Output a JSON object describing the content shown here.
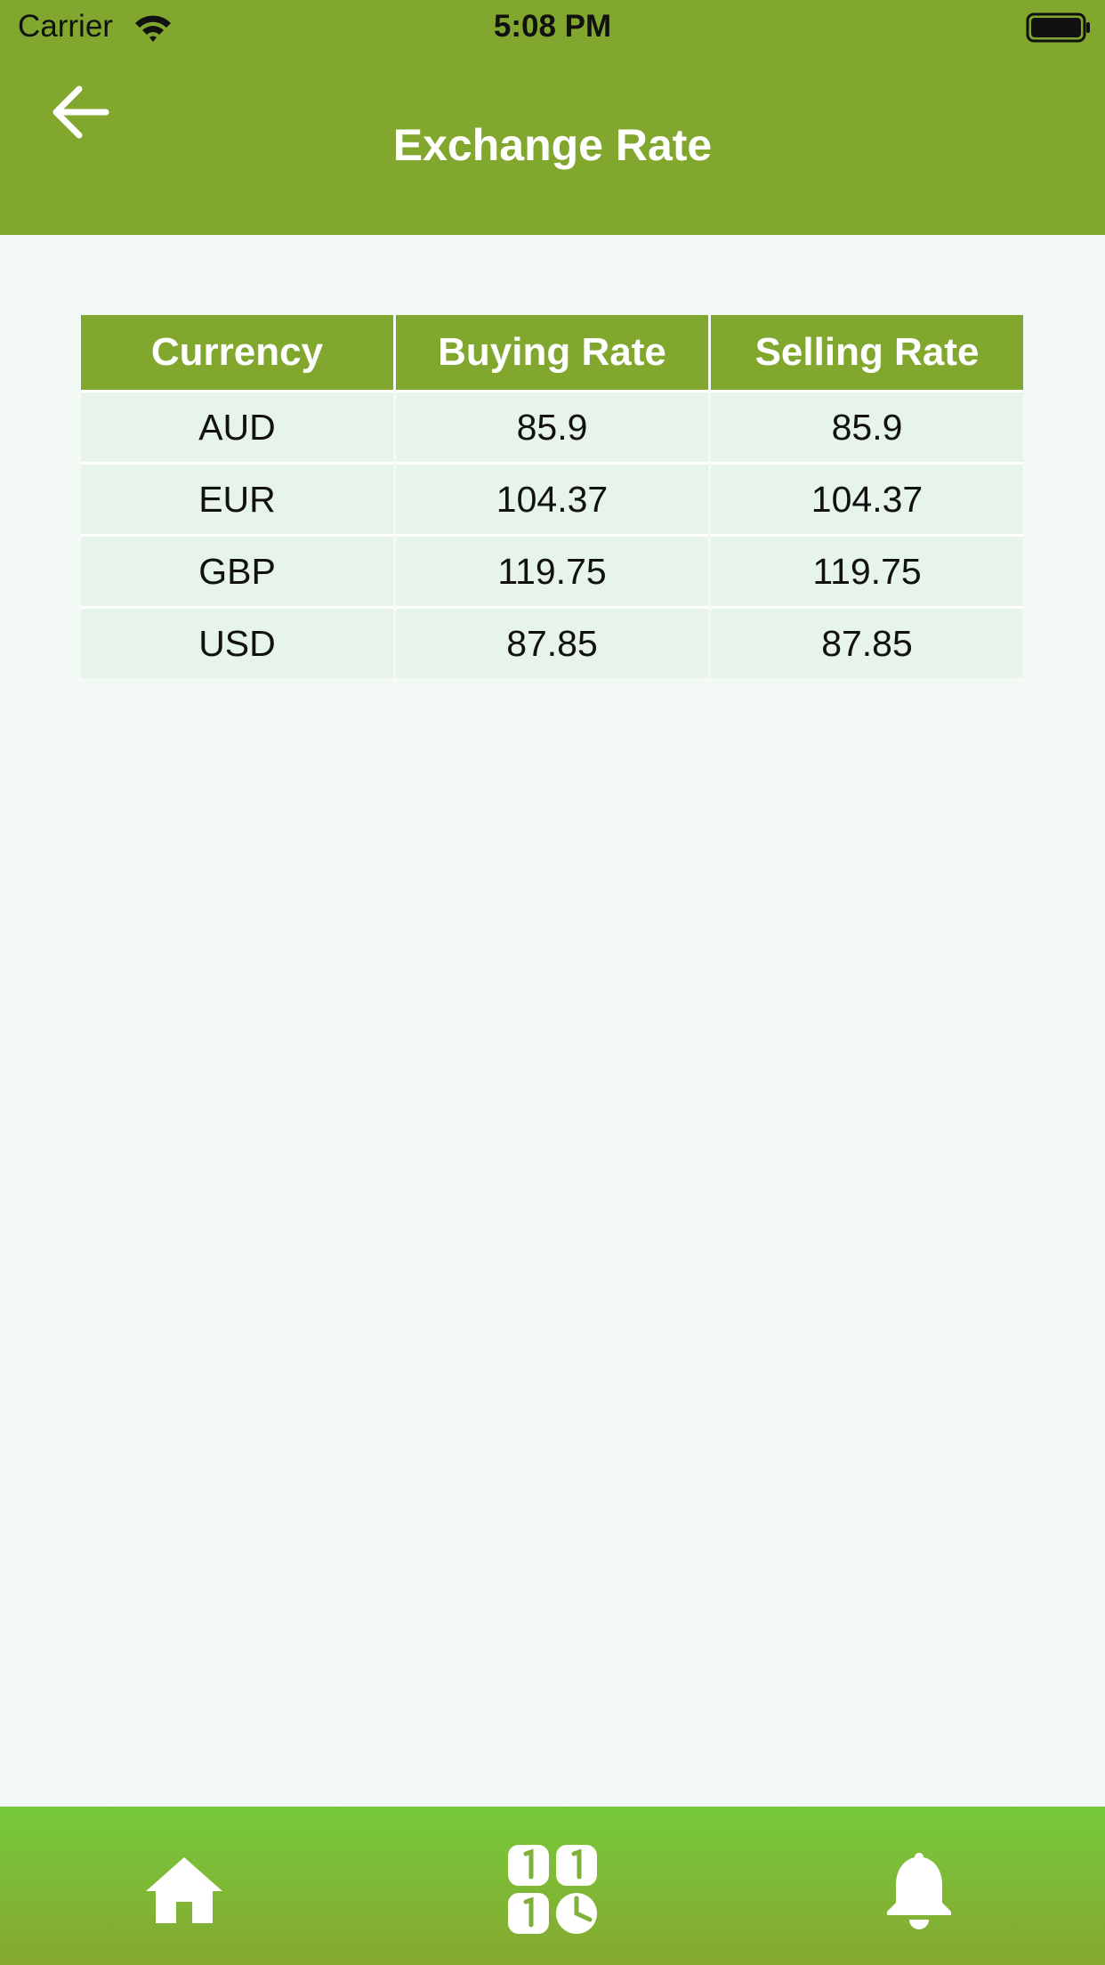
{
  "status_bar": {
    "carrier": "Carrier",
    "time": "5:08 PM"
  },
  "header": {
    "title": "Exchange Rate",
    "back_icon": "arrow-left-icon"
  },
  "table": {
    "columns": [
      "Currency",
      "Buying Rate",
      "Selling Rate"
    ],
    "rows": [
      [
        "AUD",
        "85.9",
        "85.9"
      ],
      [
        "EUR",
        "104.37",
        "104.37"
      ],
      [
        "GBP",
        "119.75",
        "119.75"
      ],
      [
        "USD",
        "87.85",
        "87.85"
      ]
    ]
  },
  "tabs": [
    {
      "icon": "home-icon"
    },
    {
      "icon": "apps-grid-icon"
    },
    {
      "icon": "bell-icon"
    }
  ],
  "colors": {
    "primary": "#81a72f",
    "tab_bar_top": "#76c93b",
    "row_bg": "#e7f4ea",
    "page_bg": "#f3f9f5"
  }
}
